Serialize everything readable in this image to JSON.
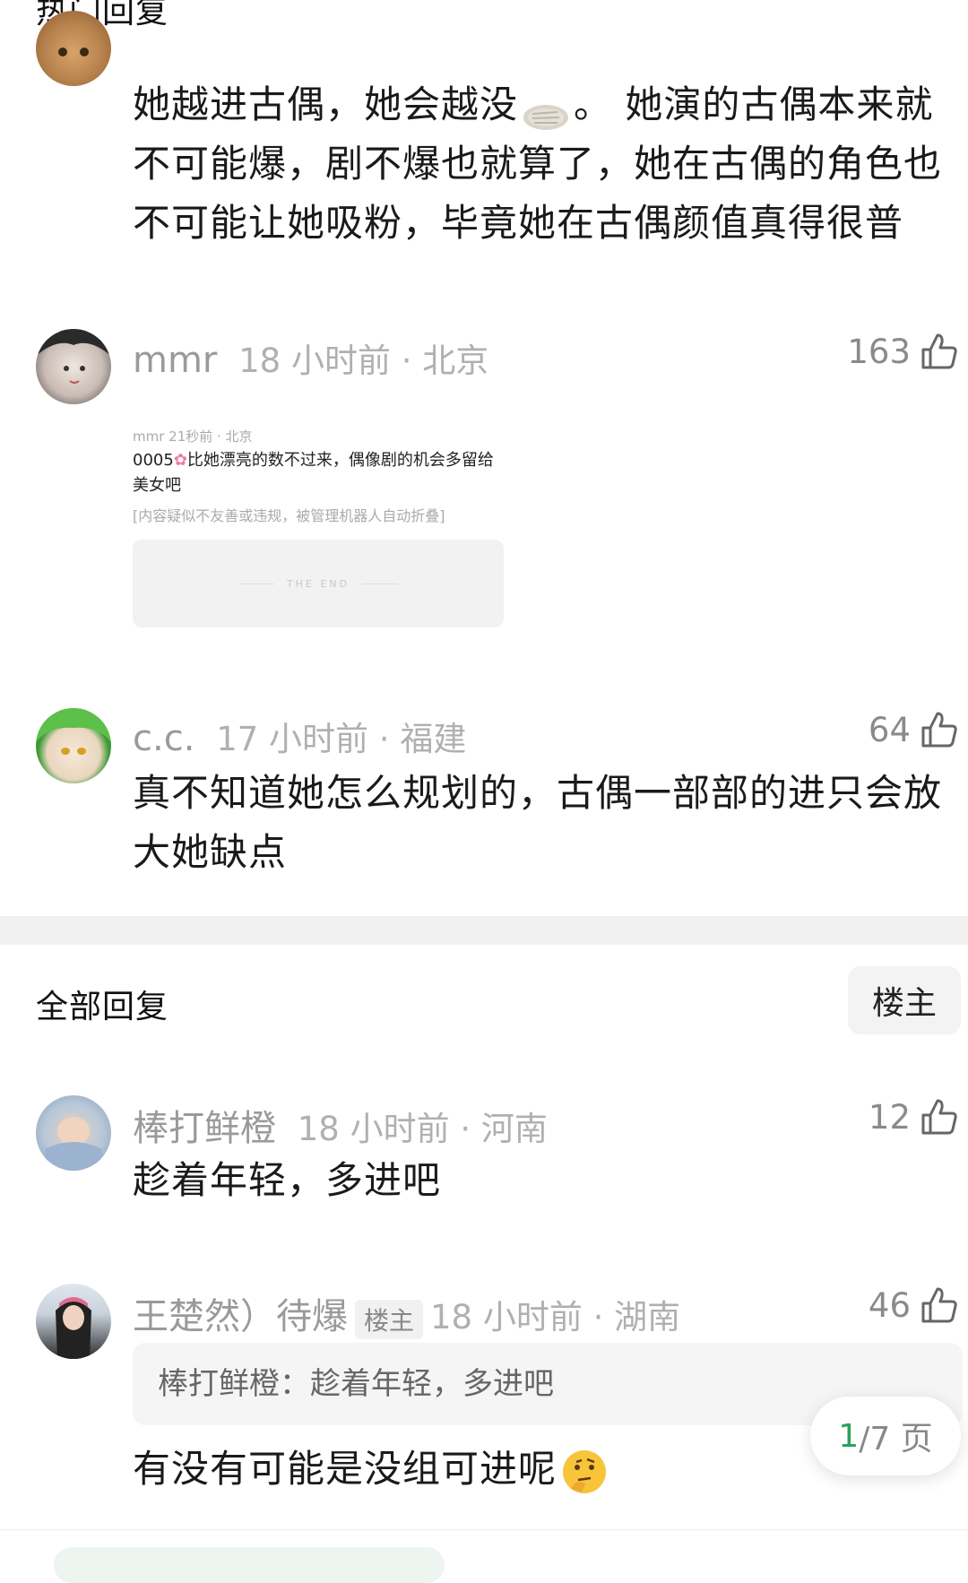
{
  "hot_section": {
    "title": "热门回复"
  },
  "all_section": {
    "title": "全部回复",
    "filter_label": "楼主"
  },
  "colors": {
    "accent": "#27a35a",
    "meta_gray": "#b0b0b0"
  },
  "hot_comments": [
    {
      "text": "她越进古偶，她会越没",
      "text_end": "。 她演的古偶本来就不可能爆，剧不爆也就算了，她在古偶的角色也不可能让她吸粉，毕竟她在古偶颜值真得很普",
      "emoji": "flatbread-icon"
    },
    {
      "username": "mmr",
      "time_location": "18 小时前 · 北京",
      "likes": "163",
      "embedded": {
        "meta": "mmr 21秒前 · 北京",
        "text": "0005",
        "text_end": "比她漂亮的数不过来，偶像剧的机会多留给美女吧",
        "notice": "[内容疑似不友善或违规，被管理机器人自动折叠]",
        "end_label": "THE END"
      }
    },
    {
      "username": "c.c.",
      "time_location": "17 小时前 · 福建",
      "likes": "64",
      "text": "真不知道她怎么规划的，古偶一部部的进只会放大她缺点"
    }
  ],
  "all_comments": [
    {
      "username": "棒打鲜橙",
      "time_location": "18 小时前 · 河南",
      "likes": "12",
      "text": "趁着年轻，多进吧"
    },
    {
      "username": "王楚然）待爆",
      "owner_tag": "楼主",
      "time_location": "18 小时前 · 湖南",
      "likes": "46",
      "quote": "棒打鲜橙：趁着年轻，多进吧",
      "text": "有没有可能是没组可进呢"
    }
  ],
  "pagination": {
    "current": "1",
    "rest": "/7 页"
  }
}
